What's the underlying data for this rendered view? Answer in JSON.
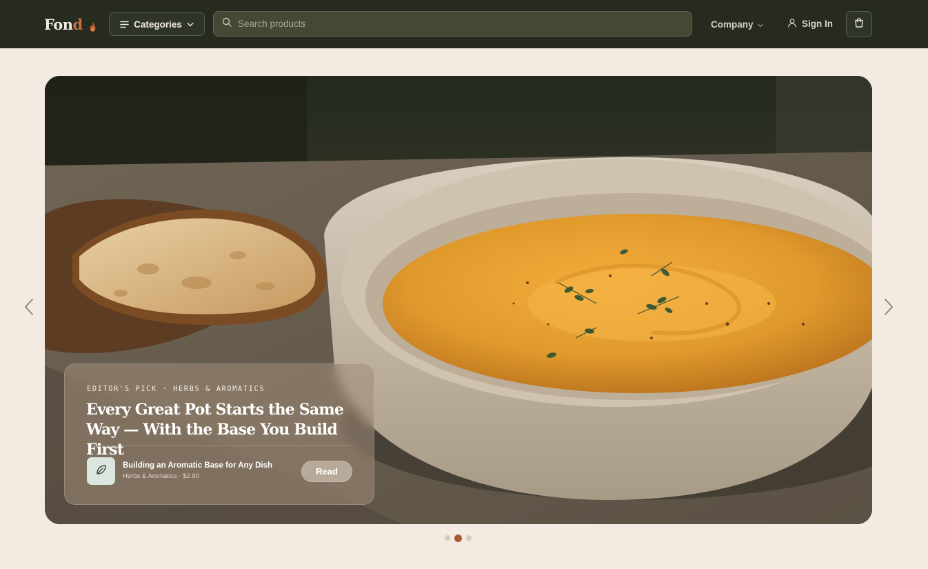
{
  "header": {
    "logo": {
      "main": "Fon",
      "accent": "d"
    },
    "categories_label": "Categories",
    "search_placeholder": "Search products",
    "company_label": "Company",
    "signin_label": "Sign In"
  },
  "hero": {
    "eyebrow": "EDITOR'S PICK · HERBS & AROMATICS",
    "title": "Every Great Pot Starts the Same Way — With the Base You Build First",
    "item": {
      "title": "Building an Aromatic Base for Any Dish",
      "meta": "Herbs & Aromatics · $2.90"
    },
    "read_label": "Read",
    "slides_total": 3,
    "active_slide": 2
  },
  "colors": {
    "nav_bg": "#262a1f",
    "page_bg": "#f3ebe1",
    "accent": "#c0703f",
    "active_dot": "#a65c35",
    "soup": "#e09a2c"
  },
  "icons": [
    "flame-icon",
    "menu-icon",
    "chevron-down-icon",
    "search-icon",
    "user-icon",
    "shopping-bag-icon",
    "chevron-left-icon",
    "chevron-right-icon",
    "leaf-icon"
  ]
}
